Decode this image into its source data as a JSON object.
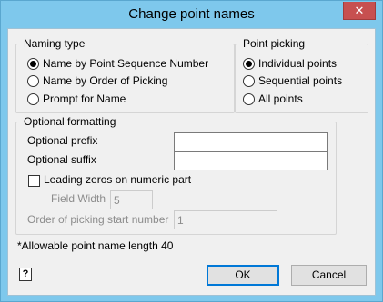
{
  "window": {
    "title": "Change point names",
    "close_glyph": "✕"
  },
  "naming_type": {
    "legend": "Naming type",
    "options": [
      {
        "label": "Name by Point Sequence Number",
        "selected": true
      },
      {
        "label": "Name by Order of Picking",
        "selected": false
      },
      {
        "label": "Prompt for Name",
        "selected": false
      }
    ]
  },
  "point_picking": {
    "legend": "Point picking",
    "options": [
      {
        "label": "Individual points",
        "selected": true
      },
      {
        "label": "Sequential points",
        "selected": false
      },
      {
        "label": "All points",
        "selected": false
      }
    ]
  },
  "optional_formatting": {
    "legend": "Optional formatting",
    "prefix_label": "Optional prefix",
    "prefix_value": "",
    "suffix_label": "Optional suffix",
    "suffix_value": "",
    "leading_zeros_label": "Leading zeros on numeric part",
    "leading_zeros_checked": false,
    "field_width_label": "Field Width",
    "field_width_value": "5",
    "start_number_label": "Order of picking start number",
    "start_number_value": "1"
  },
  "info_text": "*Allowable point name length 40",
  "buttons": {
    "ok": "OK",
    "cancel": "Cancel",
    "help_glyph": "?"
  }
}
